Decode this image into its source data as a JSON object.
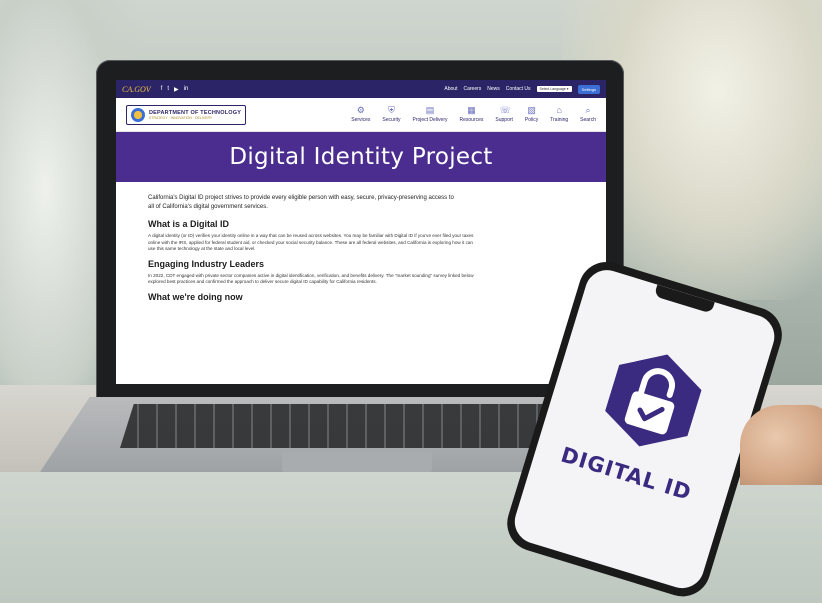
{
  "site": {
    "ca_logo": "CA.GOV",
    "social": [
      "f",
      "t",
      "▶",
      "in"
    ],
    "top_links": [
      "About",
      "Careers",
      "News",
      "Contact Us"
    ],
    "language": "Select Language ▾",
    "settings_label": "Settings",
    "org_name": "DEPARTMENT OF TECHNOLOGY",
    "org_tagline": "STRATEGY · INNOVATION · DELIVERY",
    "nav": [
      "Services",
      "Security",
      "Project Delivery",
      "Resources",
      "Support",
      "Policy",
      "Training",
      "Search"
    ],
    "hero_title": "Digital Identity Project",
    "intro": "California's Digital ID project strives to provide every eligible person with easy, secure, privacy-preserving access to all of California's digital government services.",
    "section1_title": "What is a Digital ID",
    "section1_body": "A digital identity (or ID) verifies your identity online in a way that can be reused across websites. You may be familiar with Digital ID if you've ever filed your taxes online with the IRS, applied for federal student aid, or checked your social security balance. These are all federal websites, and California is exploring how it can use this same technology at the state and local level.",
    "section2_title": "Engaging Industry Leaders",
    "section2_body": "In 2022, CDT engaged with private sector companies active in digital identification, verification, and benefits delivery. The \"market sounding\" survey linked below explored best practices and confirmed the approach to deliver secure digital ID capability for California residents.",
    "section3_title": "What we're doing now"
  },
  "phone": {
    "label": "DIGITAL ID"
  },
  "colors": {
    "primary": "#2b2567",
    "hero": "#4b2c8f",
    "accent": "#3b6fd6",
    "badge": "#3a2a80"
  },
  "icons": [
    "services-icon",
    "security-icon",
    "project-delivery-icon",
    "resources-icon",
    "support-icon",
    "policy-icon",
    "training-icon",
    "search-icon",
    "unlocked-padlock-icon"
  ]
}
